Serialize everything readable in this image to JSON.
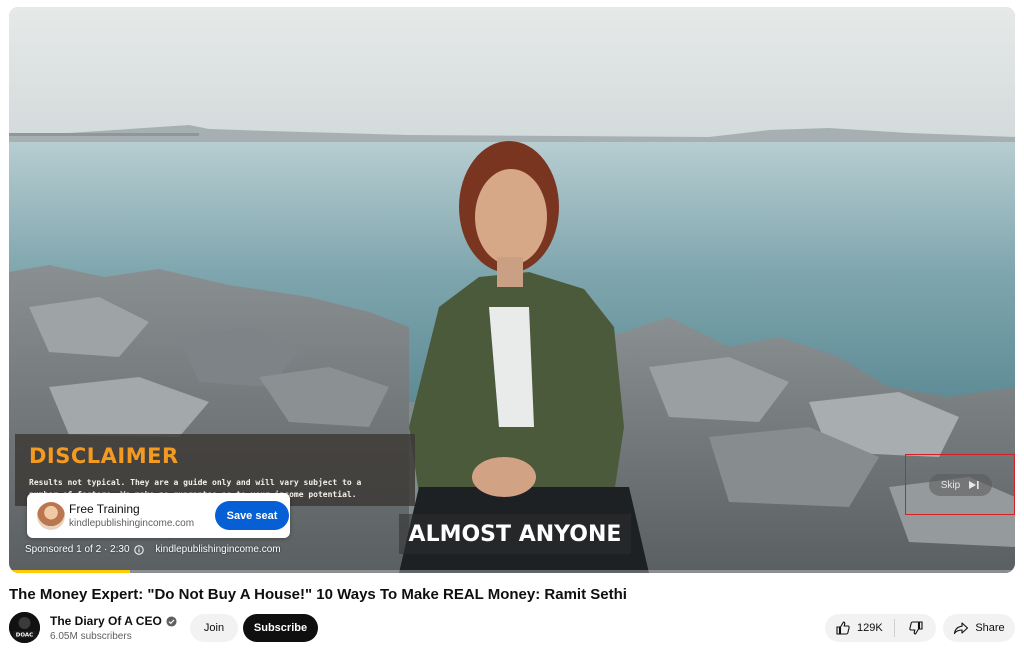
{
  "ad": {
    "disclaimer_title": "DISCLAIMER",
    "disclaimer_line1": "Results not typical. They are a guide only and will vary subject to a",
    "disclaimer_line2": "number of factors. We make no guarantee as to your income potential.",
    "card_title": "Free Training",
    "card_url": "kindlepublishingincome.com",
    "card_cta": "Save seat",
    "sponsored_label": "Sponsored 1 of 2 · 2:30",
    "sponsored_domain": "kindlepublishingincome.com",
    "caption": "ALMOST ANYONE",
    "skip_label": "Skip",
    "progress_fraction": 0.12
  },
  "video": {
    "title": "The Money Expert: \"Do Not Buy A House!\" 10 Ways To Make REAL Money: Ramit Sethi"
  },
  "channel": {
    "name": "The Diary Of A CEO",
    "subscribers": "6.05M subscribers",
    "avatar_text": "DOAC",
    "join_label": "Join",
    "subscribe_label": "Subscribe"
  },
  "actions": {
    "like_count": "129K",
    "share_label": "Share"
  },
  "colors": {
    "accent_blue": "#065fd4",
    "ad_progress": "#ffcc00",
    "highlight_red": "#d42222",
    "disclaimer_orange": "#f39a21"
  }
}
